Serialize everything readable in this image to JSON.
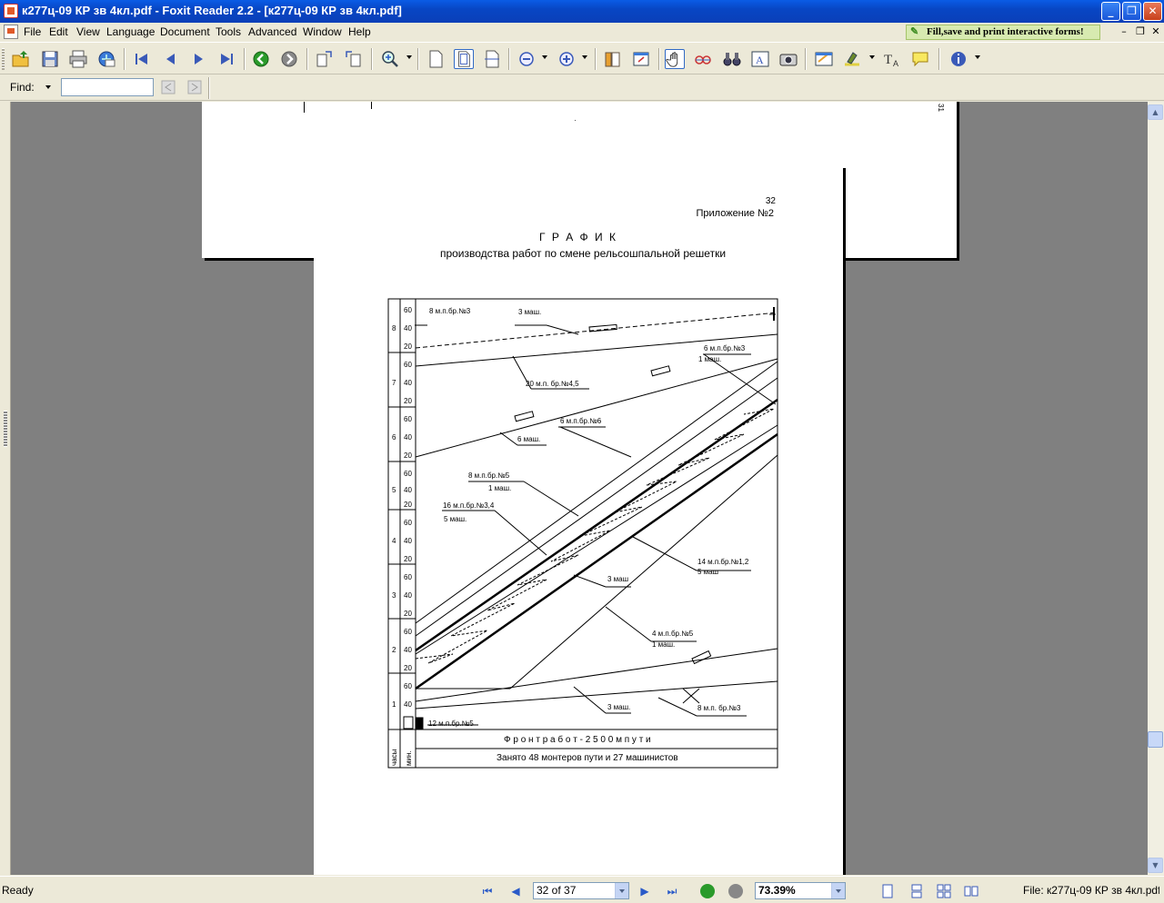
{
  "window": {
    "title": "к277ц-09 КР зв 4кл.pdf - Foxit Reader 2.2 - [к277ц-09 КР зв 4кл.pdf]"
  },
  "menu": {
    "items": [
      "File",
      "Edit",
      "View",
      "Language",
      "Document",
      "Tools",
      "Advanced",
      "Window",
      "Help"
    ]
  },
  "promo": {
    "text": "Fill,save and print interactive forms!"
  },
  "find": {
    "label": "Find:",
    "value": ""
  },
  "document": {
    "prev_page_number": "31",
    "page_number": "32",
    "appendix": "Приложение №2",
    "title": "Г Р А Ф И К",
    "subtitle": "производства работ по смене рельсошпальной решетки",
    "chart": {
      "hour_labels": [
        "8",
        "7",
        "6",
        "5",
        "4",
        "3",
        "2",
        "1"
      ],
      "minute_ticks": [
        [
          "60",
          "40",
          "20"
        ],
        [
          "60",
          "40",
          "20"
        ],
        [
          "60",
          "40",
          "20"
        ],
        [
          "60",
          "40",
          "20"
        ],
        [
          "60",
          "40",
          "20"
        ],
        [
          "60",
          "40",
          "20"
        ],
        [
          "60",
          "40",
          "20"
        ],
        [
          "60",
          "40"
        ]
      ],
      "axis_hours": "часы",
      "axis_minutes": "мин.",
      "front": "Ф р о н т   р а б о т  - 2 5 0 0  м   п у т и",
      "staff": "Занято  48  монтеров пути и  27  машинистов",
      "annotations": [
        "8 м.п.бр.№3",
        "3 маш.",
        "6 м.п.бр.№3",
        "1 маш.",
        "20 м.п. бр.№4,5",
        "6 м.п.бр.№6",
        "6 маш.",
        "8 м.п.бр.№5",
        "1 маш.",
        "16 м.п.бр.№3,4",
        "5 маш.",
        "14 м.п.бр.№1,2",
        "5 маш",
        "3 маш",
        "4 м.п.бр.№5",
        "1 маш.",
        "3 маш.",
        "8 м.п. бр.№3",
        "12 м.п.бр.№5"
      ]
    }
  },
  "status": {
    "text": "Ready",
    "page": "32 of 37",
    "zoom": "73.39%",
    "file": "File: к277ц-09 КР зв 4кл.pdf [8"
  },
  "colors": {
    "titlebar": "#0a4fd6",
    "chrome": "#ece9d8",
    "workspace": "#808080",
    "promo": "#d7eab0"
  }
}
